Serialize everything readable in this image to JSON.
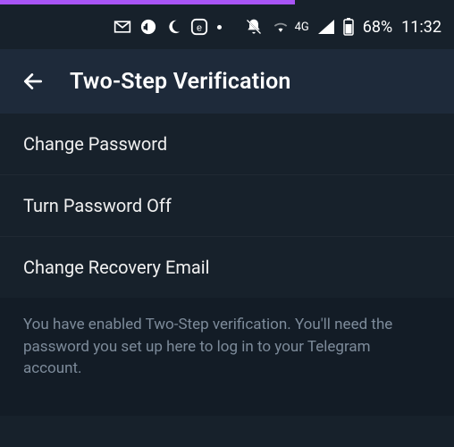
{
  "status_bar": {
    "icons": {
      "gmail": "gmail-icon",
      "mute": "mute-icon",
      "moon": "moon-icon",
      "app_e": "app-e-icon",
      "dot": "dot-icon",
      "notif_off": "notifications-off-icon",
      "wifi": "wifi-icon",
      "network_label": "4G",
      "signal": "signal-icon",
      "battery": "battery-icon"
    },
    "battery_text": "68%",
    "time_text": "11:32"
  },
  "header": {
    "back_icon": "arrow-back-icon",
    "title": "Two-Step Verification"
  },
  "options": [
    {
      "label": "Change Password"
    },
    {
      "label": "Turn Password Off"
    },
    {
      "label": "Change Recovery Email"
    }
  ],
  "footer_note": "You have enabled Two-Step verification. You'll need the password you set up here to log in to your Telegram account.",
  "colors": {
    "accent": "#a855f7",
    "bg_dark": "#17212b",
    "bg_header": "#1e2a3a",
    "bg_footer": "#131c26",
    "muted_text": "#7d8b9a"
  }
}
